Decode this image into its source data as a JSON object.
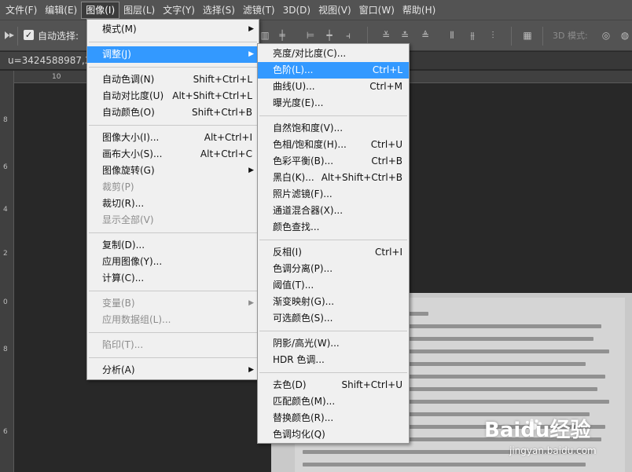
{
  "menubar": [
    {
      "label": "文件(F)",
      "active": false
    },
    {
      "label": "编辑(E)",
      "active": false
    },
    {
      "label": "图像(I)",
      "active": true
    },
    {
      "label": "图层(L)",
      "active": false
    },
    {
      "label": "文字(Y)",
      "active": false
    },
    {
      "label": "选择(S)",
      "active": false
    },
    {
      "label": "滤镜(T)",
      "active": false
    },
    {
      "label": "3D(D)",
      "active": false
    },
    {
      "label": "视图(V)",
      "active": false
    },
    {
      "label": "窗口(W)",
      "active": false
    },
    {
      "label": "帮助(H)",
      "active": false
    }
  ],
  "options": {
    "auto_select_label": "自动选择:",
    "auto_select_checked": true,
    "mode_3d_label": "3D 模式:"
  },
  "doc_tab": "u=3424588987,3",
  "rulers": {
    "h": [
      "10"
    ],
    "v": [
      "8",
      "6",
      "4",
      "2",
      "0",
      "8",
      "6"
    ]
  },
  "image_menu": {
    "items": [
      {
        "label": "模式(M)",
        "submenu": true
      },
      {
        "divider": true
      },
      {
        "label": "调整(J)",
        "submenu": true,
        "highlighted": true
      },
      {
        "divider": true
      },
      {
        "label": "自动色调(N)",
        "shortcut": "Shift+Ctrl+L"
      },
      {
        "label": "自动对比度(U)",
        "shortcut": "Alt+Shift+Ctrl+L"
      },
      {
        "label": "自动颜色(O)",
        "shortcut": "Shift+Ctrl+B"
      },
      {
        "divider": true
      },
      {
        "label": "图像大小(I)...",
        "shortcut": "Alt+Ctrl+I"
      },
      {
        "label": "画布大小(S)...",
        "shortcut": "Alt+Ctrl+C"
      },
      {
        "label": "图像旋转(G)",
        "submenu": true
      },
      {
        "label": "裁剪(P)",
        "disabled": true
      },
      {
        "label": "裁切(R)..."
      },
      {
        "label": "显示全部(V)",
        "disabled": true
      },
      {
        "divider": true
      },
      {
        "label": "复制(D)..."
      },
      {
        "label": "应用图像(Y)..."
      },
      {
        "label": "计算(C)..."
      },
      {
        "divider": true
      },
      {
        "label": "变量(B)",
        "submenu": true,
        "disabled": true
      },
      {
        "label": "应用数据组(L)...",
        "disabled": true
      },
      {
        "divider": true
      },
      {
        "label": "陷印(T)...",
        "disabled": true
      },
      {
        "divider": true
      },
      {
        "label": "分析(A)",
        "submenu": true
      }
    ]
  },
  "adjust_menu": {
    "items": [
      {
        "label": "亮度/对比度(C)..."
      },
      {
        "label": "色阶(L)...",
        "shortcut": "Ctrl+L",
        "highlighted": true
      },
      {
        "label": "曲线(U)...",
        "shortcut": "Ctrl+M"
      },
      {
        "label": "曝光度(E)..."
      },
      {
        "divider": true
      },
      {
        "label": "自然饱和度(V)..."
      },
      {
        "label": "色相/饱和度(H)...",
        "shortcut": "Ctrl+U"
      },
      {
        "label": "色彩平衡(B)...",
        "shortcut": "Ctrl+B"
      },
      {
        "label": "黑白(K)...",
        "shortcut": "Alt+Shift+Ctrl+B"
      },
      {
        "label": "照片滤镜(F)..."
      },
      {
        "label": "通道混合器(X)..."
      },
      {
        "label": "颜色查找..."
      },
      {
        "divider": true
      },
      {
        "label": "反相(I)",
        "shortcut": "Ctrl+I"
      },
      {
        "label": "色调分离(P)..."
      },
      {
        "label": "阈值(T)..."
      },
      {
        "label": "渐变映射(G)..."
      },
      {
        "label": "可选颜色(S)..."
      },
      {
        "divider": true
      },
      {
        "label": "阴影/高光(W)..."
      },
      {
        "label": "HDR 色调..."
      },
      {
        "divider": true
      },
      {
        "label": "去色(D)",
        "shortcut": "Shift+Ctrl+U"
      },
      {
        "label": "匹配颜色(M)..."
      },
      {
        "label": "替换颜色(R)..."
      },
      {
        "label": "色调均化(Q)"
      }
    ]
  },
  "watermark": {
    "brand": "Baidu经验",
    "url": "jingyan.baidu.com"
  },
  "colors": {
    "highlight": "#3399ff",
    "menubar": "#535353",
    "canvas": "#282828"
  }
}
